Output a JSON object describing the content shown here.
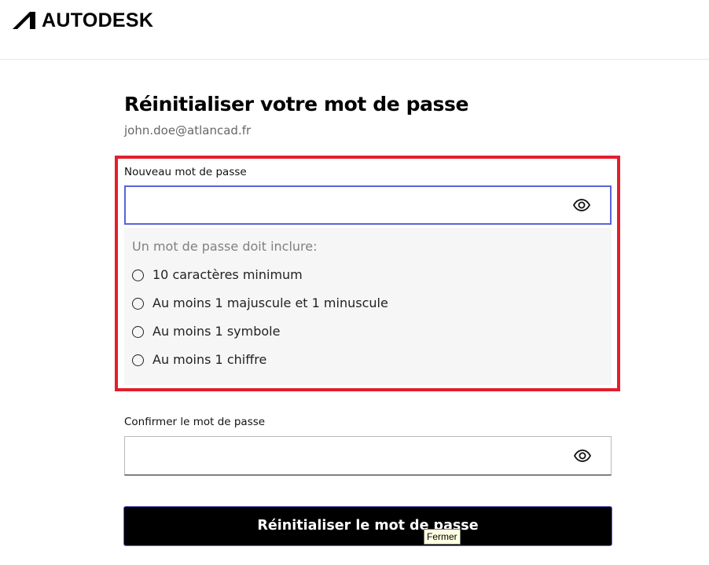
{
  "header": {
    "brand": "AUTODESK",
    "logo_icon": "autodesk-logo-icon"
  },
  "page": {
    "title": "Réinitialiser votre mot de passe",
    "email": "john.doe@atlancad.fr"
  },
  "new_password": {
    "label": "Nouveau mot de passe",
    "value": "",
    "toggle_icon": "eye-icon"
  },
  "requirements": {
    "title": "Un mot de passe doit inclure:",
    "items": [
      {
        "label": "10 caractères minimum",
        "met": false
      },
      {
        "label": "Au moins 1 majuscule et 1 minuscule",
        "met": false
      },
      {
        "label": "Au moins 1 symbole",
        "met": false
      },
      {
        "label": "Au moins 1 chiffre",
        "met": false
      }
    ]
  },
  "confirm_password": {
    "label": "Confirmer le mot de passe",
    "value": "",
    "toggle_icon": "eye-icon"
  },
  "submit": {
    "label": "Réinitialiser le mot de passe"
  },
  "tooltip": {
    "text": "Fermer"
  },
  "colors": {
    "highlight": "#e31e2d",
    "focus": "#5864d8",
    "button_bg": "#000000"
  }
}
